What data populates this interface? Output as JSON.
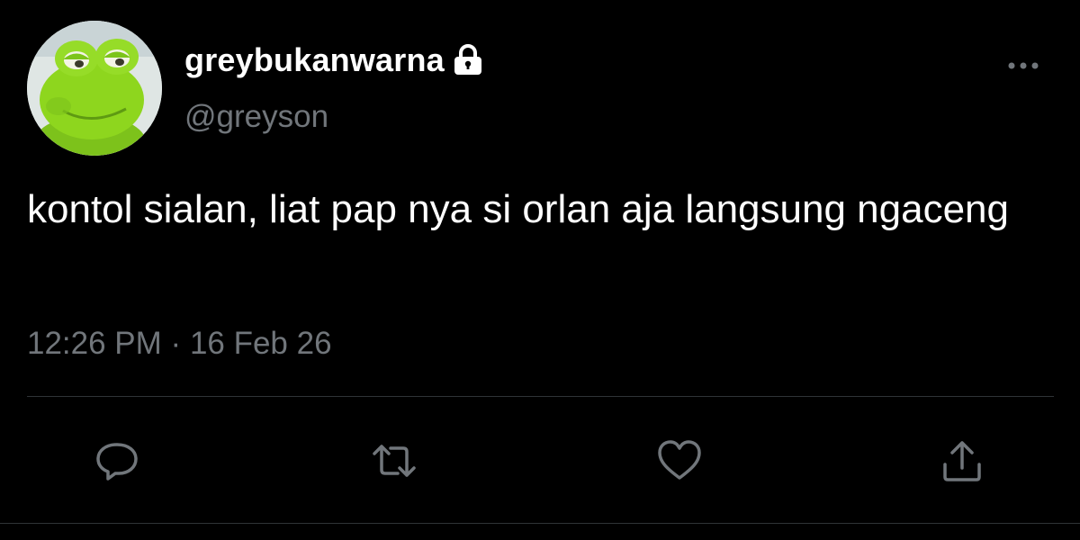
{
  "user": {
    "display_name": "greybukanwarna",
    "handle": "@greyson",
    "avatar_icon": "frog-avatar",
    "protected_icon": "lock-icon"
  },
  "tweet": {
    "text": "kontol sialan, liat pap nya si orlan aja langsung ngaceng",
    "time": "12:26 PM",
    "separator": "·",
    "date": "16 Feb 26"
  },
  "actions": {
    "more_icon": "more-dots-icon",
    "reply_icon": "reply-icon",
    "retweet_icon": "retweet-icon",
    "like_icon": "heart-icon",
    "share_icon": "share-icon"
  },
  "colors": {
    "background": "#000000",
    "primary_text": "#ffffff",
    "secondary_text": "#71767b",
    "divider": "#2f3336",
    "avatar_frog": "#8ed61e"
  }
}
